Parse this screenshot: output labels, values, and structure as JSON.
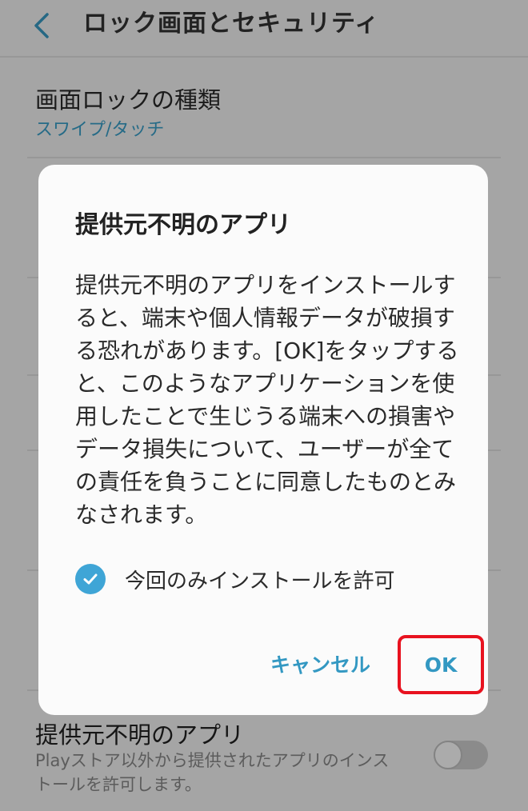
{
  "header": {
    "title": "ロック画面とセキュリティ",
    "back_icon": "chevron-left-icon"
  },
  "settings": {
    "lock_type": {
      "title": "画面ロックの種類",
      "value": "スワイプ/タッチ"
    },
    "unknown_apps": {
      "title": "提供元不明のアプリ",
      "description": "Playストア以外から提供されたアプリのインストールを許可します。",
      "enabled": false
    }
  },
  "dialog": {
    "title": "提供元不明のアプリ",
    "body": "提供元不明のアプリをインストールすると、端末や個人情報データが破損する恐れがあります。[OK]をタップすると、このようなアプリケーションを使用したことで生じうる端末への損害やデータ損失について、ユーザーが全ての責任を負うことに同意したものとみなされます。",
    "checkbox_label": "今回のみインストールを許可",
    "checkbox_checked": true,
    "cancel_label": "キャンセル",
    "ok_label": "OK"
  },
  "colors": {
    "accent": "#39a0c9",
    "checkbox": "#3fa5d6",
    "highlight": "#e8121f"
  }
}
